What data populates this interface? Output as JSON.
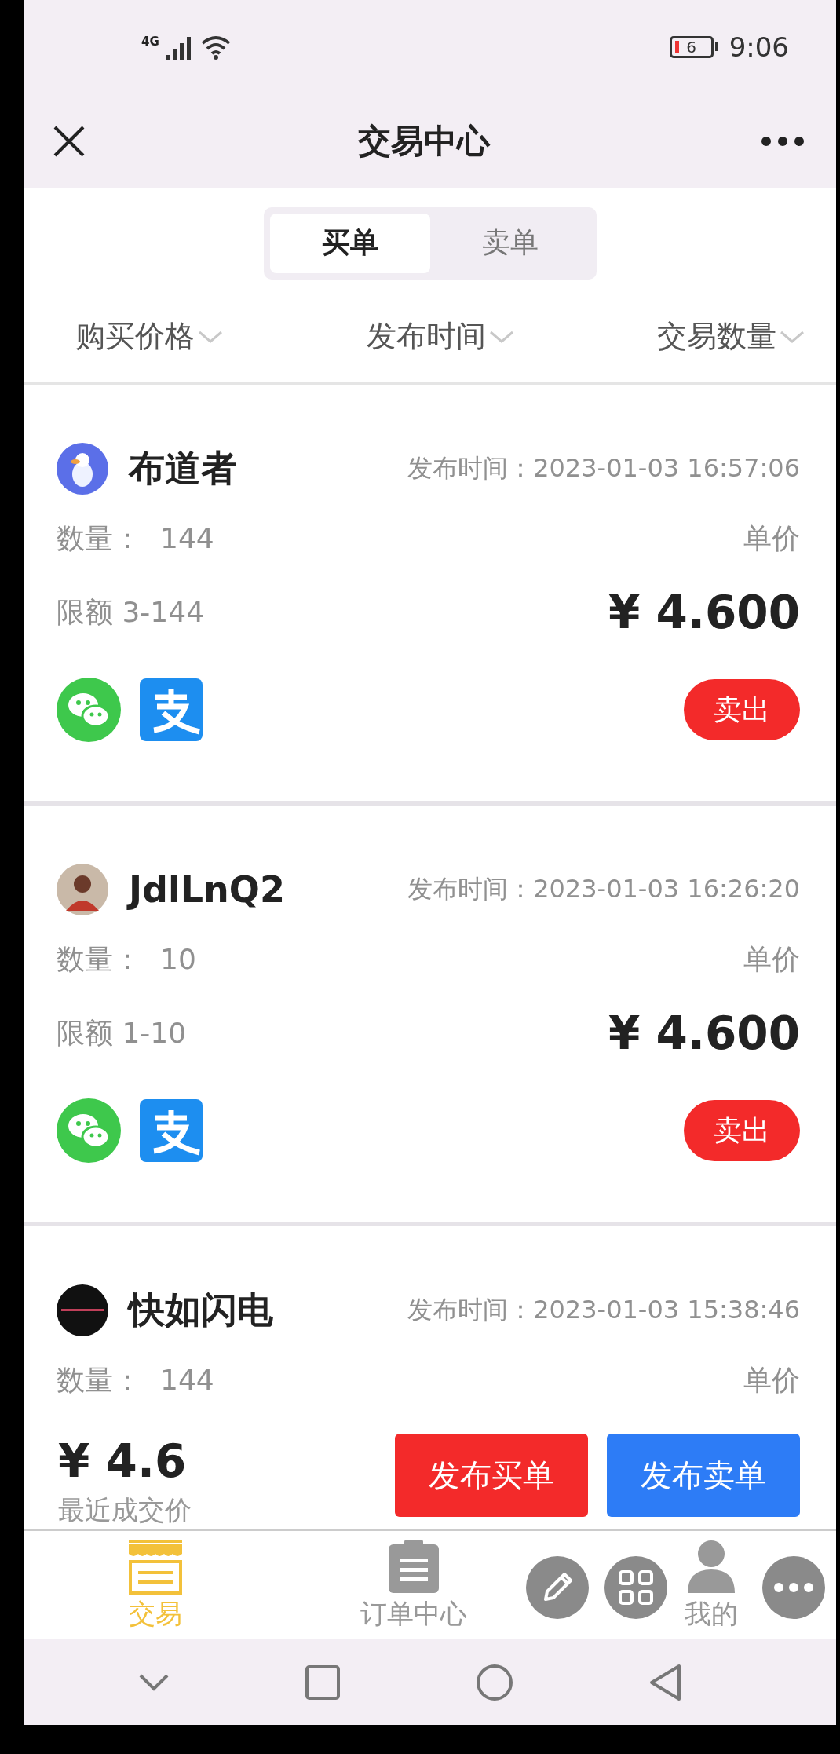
{
  "status_bar": {
    "network": "4G",
    "battery": "6",
    "time": "9:06"
  },
  "header": {
    "title": "交易中心"
  },
  "tabs": [
    {
      "label": "买单",
      "selected": true
    },
    {
      "label": "卖单",
      "selected": false
    }
  ],
  "filters": [
    "购买价格",
    "发布时间",
    "交易数量"
  ],
  "orders": [
    {
      "name": "布道者",
      "posted_label": "发布时间：",
      "posted_time": "2023-01-03 16:57:06",
      "quantity_label": "数量：",
      "quantity": "144",
      "unit_price_label": "单价",
      "limit": "限额 3-144",
      "price": "¥ 4.600",
      "payments": [
        {
          "kind": "wechat"
        },
        {
          "kind": "alipay"
        }
      ],
      "action": "卖出"
    },
    {
      "name": "JdlLnQ2",
      "posted_label": "发布时间：",
      "posted_time": "2023-01-03 16:26:20",
      "quantity_label": "数量：",
      "quantity": "10",
      "unit_price_label": "单价",
      "limit": "限额 1-10",
      "price": "¥ 4.600",
      "payments": [
        {
          "kind": "wechat"
        },
        {
          "kind": "alipay"
        }
      ],
      "action": "卖出"
    },
    {
      "name": "快如闪电",
      "posted_label": "发布时间：",
      "posted_time": "2023-01-03 15:38:46",
      "quantity_label": "数量：",
      "quantity": "144",
      "unit_price_label": "单价"
    }
  ],
  "footer": {
    "last_price": "¥ 4.6",
    "last_price_label": "最近成交价",
    "buttons": [
      {
        "label": "发布买单",
        "kind": "buy"
      },
      {
        "label": "发布卖单",
        "kind": "sell"
      }
    ]
  },
  "bottom_nav": [
    {
      "label": "交易",
      "kind": "store",
      "selected": true
    },
    {
      "label": "订单中心",
      "kind": "orders",
      "selected": false
    },
    {
      "label": "我的",
      "kind": "profile",
      "selected": false
    }
  ]
}
